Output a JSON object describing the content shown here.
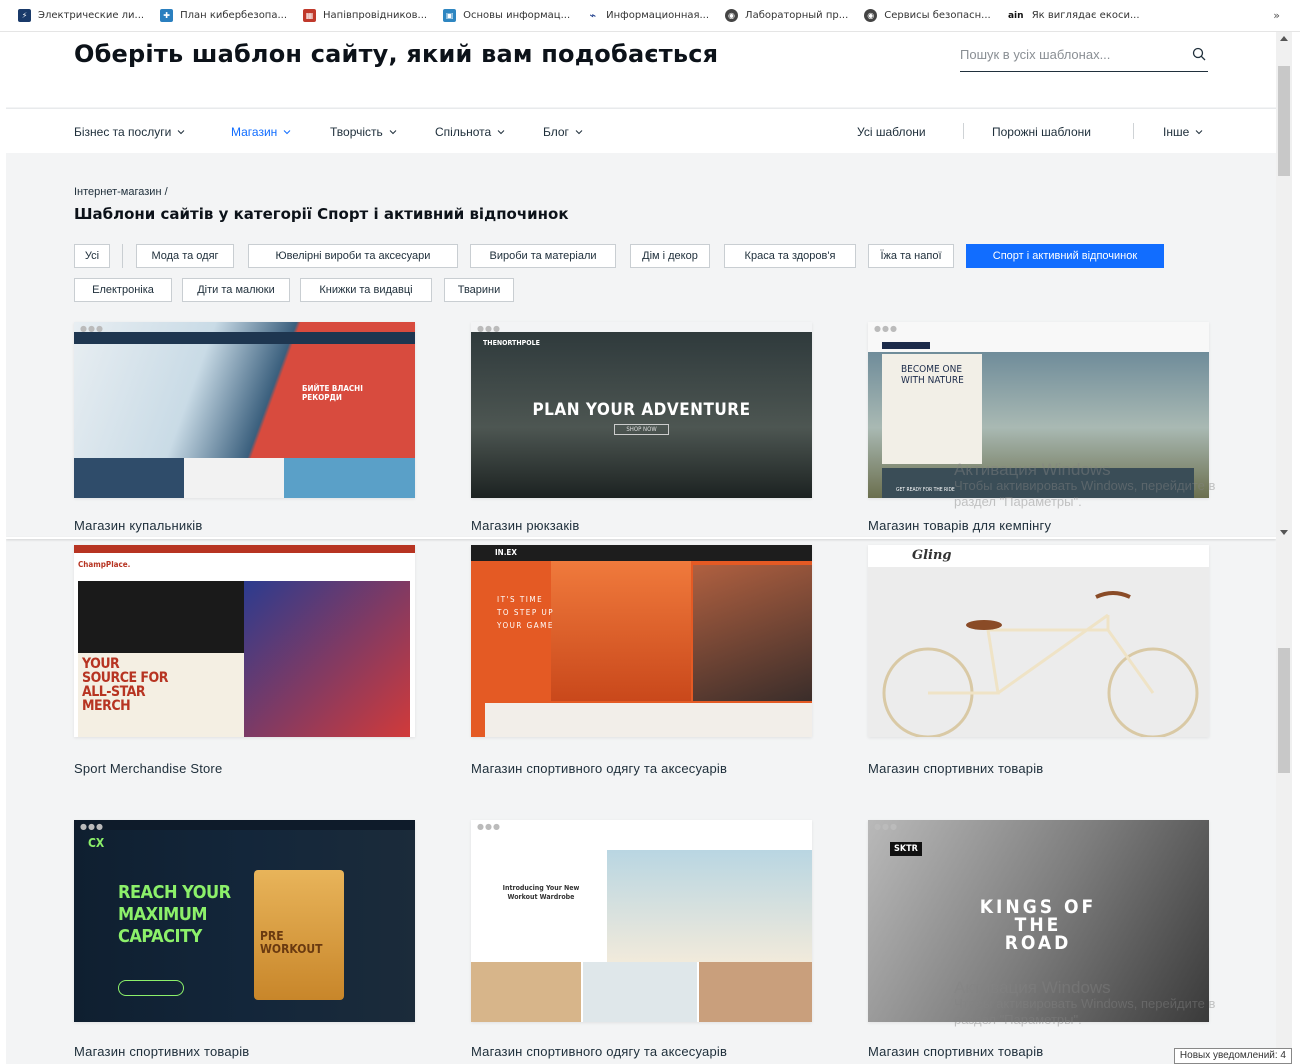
{
  "bookmarks": [
    {
      "label": "Электрические ли...",
      "color": "#1a3a6a",
      "glyph": "⚡"
    },
    {
      "label": "План кибербезопа...",
      "color": "#2a7fbf",
      "glyph": "✚"
    },
    {
      "label": "Напівпровідников...",
      "color": "#c0392b",
      "glyph": "▦"
    },
    {
      "label": "Основы информац...",
      "color": "#2e86c1",
      "glyph": "▣"
    },
    {
      "label": "Информационная...",
      "color": "#ffffff",
      "glyph": "⌁"
    },
    {
      "label": "Лабораторный пр...",
      "color": "#444444",
      "glyph": "◉"
    },
    {
      "label": "Сервисы безопасн...",
      "color": "#444444",
      "glyph": "◉"
    },
    {
      "label": "Як виглядає екоси...",
      "color": "#ffffff",
      "glyph": "ain"
    }
  ],
  "bookmarks_more": "»",
  "header": {
    "title": "Оберіть шаблон сайту, який вам подобається",
    "search_placeholder": "Пошук в усіх шаблонах..."
  },
  "nav": {
    "left": [
      {
        "label": "Бізнес та послуги"
      },
      {
        "label": "Магазин"
      },
      {
        "label": "Творчість"
      },
      {
        "label": "Спільнота"
      },
      {
        "label": "Блог"
      }
    ],
    "right": [
      {
        "label": "Усі шаблони"
      },
      {
        "label": "Порожні шаблони"
      },
      {
        "label": "Інше"
      }
    ]
  },
  "breadcrumb": "Інтернет-магазин /",
  "category_title": "Шаблони сайтів у категорії Спорт і активний відпочинок",
  "chips": {
    "row1": [
      "Усі",
      "Мода та одяг",
      "Ювелірні вироби та аксесуари",
      "Вироби та матеріали",
      "Дім і декор",
      "Краса та здоров'я",
      "Їжа та напої",
      "Спорт і активний відпочинок"
    ],
    "row2": [
      "Електроніка",
      "Діти та малюки",
      "Книжки та видавці",
      "Тварини"
    ]
  },
  "cards": [
    {
      "label": "Магазин купальників",
      "thumb_text": "БИЙТЕ ВЛАСНІ РЕКОРДИ"
    },
    {
      "label": "Магазин рюкзаків",
      "thumb_text": "PLAN YOUR ADVENTURE",
      "thumb_brand": "THENORTHPOLE",
      "thumb_btn": "SHOP NOW"
    },
    {
      "label": "Магазин товарів для кемпінгу",
      "thumb_text": "BECOME ONE WITH NATURE",
      "thumb_sub": "GET READY FOR THE RIDE"
    },
    {
      "label": "Sport Merchandise Store",
      "thumb_text": "YOUR SOURCE FOR ALL-STAR MERCH",
      "thumb_brand": "ChampPlace."
    },
    {
      "label": "Магазин спортивного одягу та аксесуарів",
      "thumb_text": "IT'S TIME TO STEP UP YOUR GAME",
      "thumb_brand": "IN.EX"
    },
    {
      "label": "Магазин спортивних товарів",
      "thumb_brand": "Gling"
    },
    {
      "label": "Магазин спортивних товарів",
      "thumb_text": "REACH YOUR MAXIMUM CAPACITY",
      "thumb_brand": "CX",
      "thumb_sub": "PRE WORKOUT"
    },
    {
      "label": "Магазин спортивного одягу та аксесуарів",
      "thumb_text": "Introducing Your New Workout Wardrobe"
    },
    {
      "label": "Магазин спортивних товарів",
      "thumb_text": "KINGS OF THE ROAD",
      "thumb_brand": "SKTR"
    }
  ],
  "watermark": {
    "line1": "Активация Windows",
    "line2": "Чтобы активировать Windows, перейдите в",
    "line3": "раздел \"Параметры\"."
  },
  "notification": "Новых уведомлений: 4",
  "colors": {
    "accent": "#116dff",
    "text": "#20303c",
    "bg": "#f3f4f5"
  }
}
